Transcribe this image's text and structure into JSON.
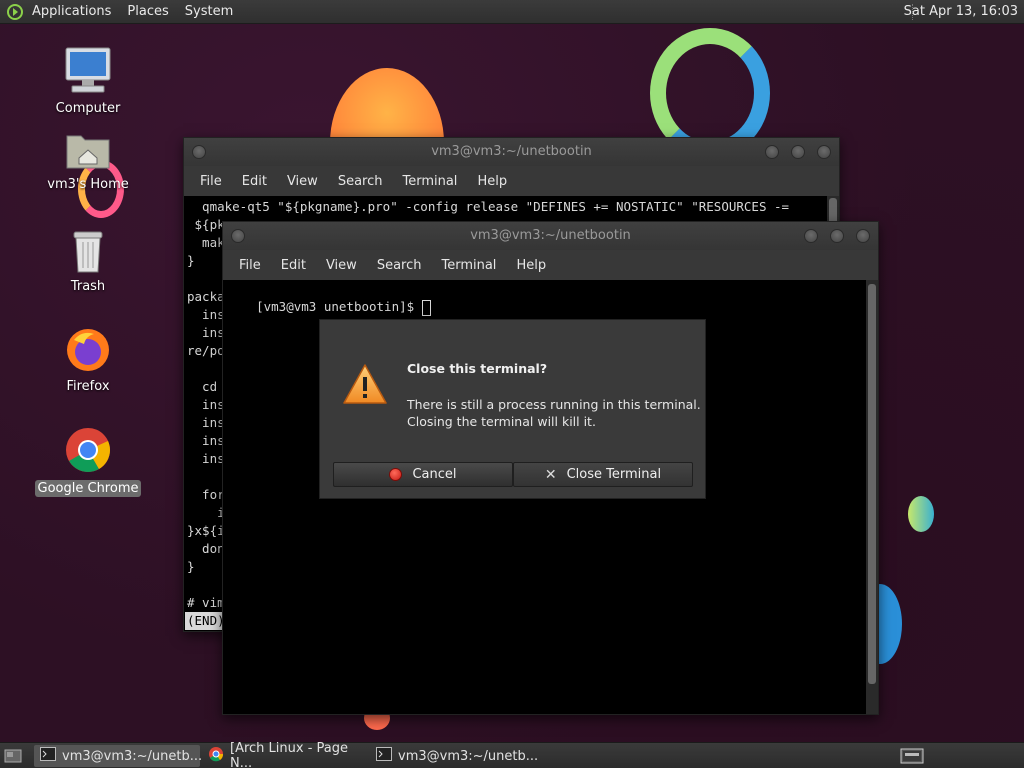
{
  "top_panel": {
    "menus": [
      "Applications",
      "Places",
      "System"
    ],
    "clock": "Sat Apr 13, 16:03"
  },
  "desktop_icons": [
    {
      "label": "Computer",
      "icon": "computer-icon"
    },
    {
      "label": "vm3's Home",
      "icon": "home-folder-icon"
    },
    {
      "label": "Trash",
      "icon": "trash-icon"
    },
    {
      "label": "Firefox",
      "icon": "firefox-icon"
    },
    {
      "label": "Google Chrome",
      "icon": "chrome-icon",
      "selected": true
    }
  ],
  "back_terminal": {
    "title": "vm3@vm3:~/unetbootin",
    "menu": [
      "File",
      "Edit",
      "View",
      "Search",
      "Terminal",
      "Help"
    ],
    "lines": [
      "  qmake-qt5 \"${pkgname}.pro\" -config release \"DEFINES += NOSTATIC\" \"RESOURCES -=",
      " ${pk",
      "  mak",
      "}",
      "",
      "packa",
      "  ins",
      "  ins",
      "re/po",
      "",
      "  cd ",
      "  ins",
      "  ins",
      "  ins",
      "  ins",
      "",
      "  for",
      "    i",
      "}x${i",
      "  don",
      "}",
      "",
      "# vim"
    ],
    "status": "(END)"
  },
  "front_terminal": {
    "title": "vm3@vm3:~/unetbootin",
    "menu": [
      "File",
      "Edit",
      "View",
      "Search",
      "Terminal",
      "Help"
    ],
    "prompt": "[vm3@vm3 unetbootin]$ "
  },
  "dialog": {
    "heading": "Close this terminal?",
    "body_line1": "There is still a process running in this terminal.",
    "body_line2": "Closing the terminal will kill it.",
    "cancel_label": "Cancel",
    "close_label": "Close Terminal"
  },
  "taskbar": {
    "tasks": [
      {
        "label": "vm3@vm3:~/unetb...",
        "icon": "terminal-icon",
        "active": true
      },
      {
        "label": "[Arch Linux - Page N...",
        "icon": "chrome-icon",
        "active": false
      },
      {
        "label": "vm3@vm3:~/unetb...",
        "icon": "terminal-icon",
        "active": false
      }
    ]
  },
  "colors": {
    "wallpaper": "#2d1024",
    "panel": "#333333",
    "cancel_dot": "#e0302f"
  }
}
